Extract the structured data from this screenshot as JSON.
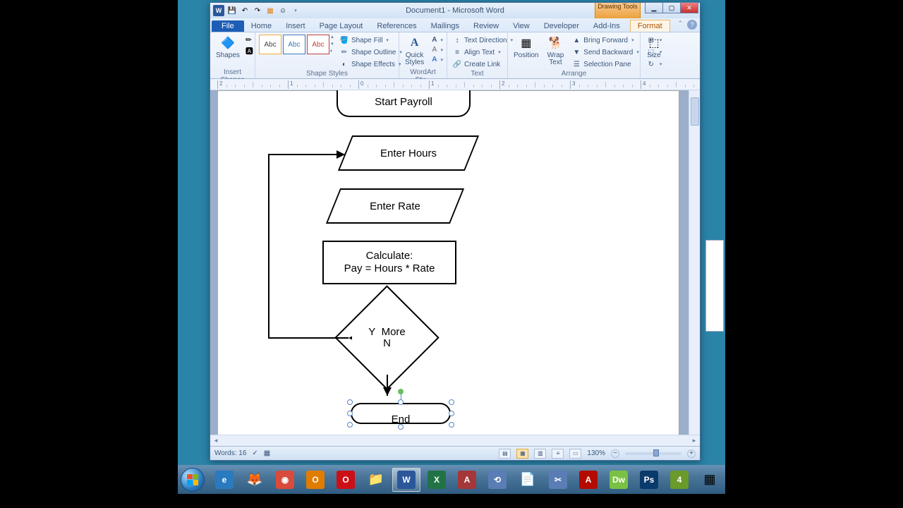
{
  "window": {
    "title": "Document1 - Microsoft Word",
    "contextual_tab_title": "Drawing Tools"
  },
  "tabs": {
    "file": "File",
    "home": "Home",
    "insert": "Insert",
    "page_layout": "Page Layout",
    "references": "References",
    "mailings": "Mailings",
    "review": "Review",
    "view": "View",
    "developer": "Developer",
    "addins": "Add-Ins",
    "format": "Format"
  },
  "ribbon": {
    "insert_shapes": {
      "shapes": "Shapes",
      "label": "Insert Shapes"
    },
    "shape_styles": {
      "swatch": "Abc",
      "fill": "Shape Fill",
      "outline": "Shape Outline",
      "effects": "Shape Effects",
      "label": "Shape Styles"
    },
    "wordart": {
      "quick_styles": "Quick\nStyles",
      "label": "WordArt Sty..."
    },
    "text": {
      "direction": "Text Direction",
      "align": "Align Text",
      "link": "Create Link",
      "label": "Text"
    },
    "arrange": {
      "position": "Position",
      "wrap_text": "Wrap\nText",
      "bring_forward": "Bring Forward",
      "send_backward": "Send Backward",
      "selection_pane": "Selection Pane",
      "label": "Arrange"
    },
    "size": {
      "size": "Size",
      "label": ""
    }
  },
  "flowchart": {
    "start": "Start Payroll",
    "enter_hours": "Enter Hours",
    "enter_rate": "Enter Rate",
    "calc1": "Calculate:",
    "calc2": "Pay = Hours * Rate",
    "decision_y": "Y",
    "decision_more": "More",
    "decision_n": "N",
    "end": "End"
  },
  "status": {
    "words": "Words: 16",
    "zoom": "130%"
  },
  "taskbar": {
    "items": [
      {
        "name": "internet-explorer",
        "glyph": "e",
        "color": "#2a7ac0"
      },
      {
        "name": "firefox",
        "glyph": "🦊",
        "color": ""
      },
      {
        "name": "chrome",
        "glyph": "◉",
        "color": "#d94b3a"
      },
      {
        "name": "outlook",
        "glyph": "O",
        "color": "#e07c00"
      },
      {
        "name": "opera",
        "glyph": "O",
        "color": "#cc0f16"
      },
      {
        "name": "explorer",
        "glyph": "📁",
        "color": ""
      },
      {
        "name": "word",
        "glyph": "W",
        "color": "#2b579a",
        "active": true
      },
      {
        "name": "excel",
        "glyph": "X",
        "color": "#217346"
      },
      {
        "name": "access",
        "glyph": "A",
        "color": "#a4373a"
      },
      {
        "name": "app-link",
        "glyph": "⟲",
        "color": "#5a7db5"
      },
      {
        "name": "notepad",
        "glyph": "📄",
        "color": ""
      },
      {
        "name": "snip",
        "glyph": "✂",
        "color": "#5a7db5"
      },
      {
        "name": "acrobat",
        "glyph": "A",
        "color": "#b30b00"
      },
      {
        "name": "dreamweaver",
        "glyph": "Dw",
        "color": "#7ac143"
      },
      {
        "name": "photoshop",
        "glyph": "Ps",
        "color": "#0a3a6b"
      },
      {
        "name": "app-4",
        "glyph": "4",
        "color": "#6a9a2a"
      },
      {
        "name": "color-app",
        "glyph": "▦",
        "color": ""
      }
    ]
  }
}
